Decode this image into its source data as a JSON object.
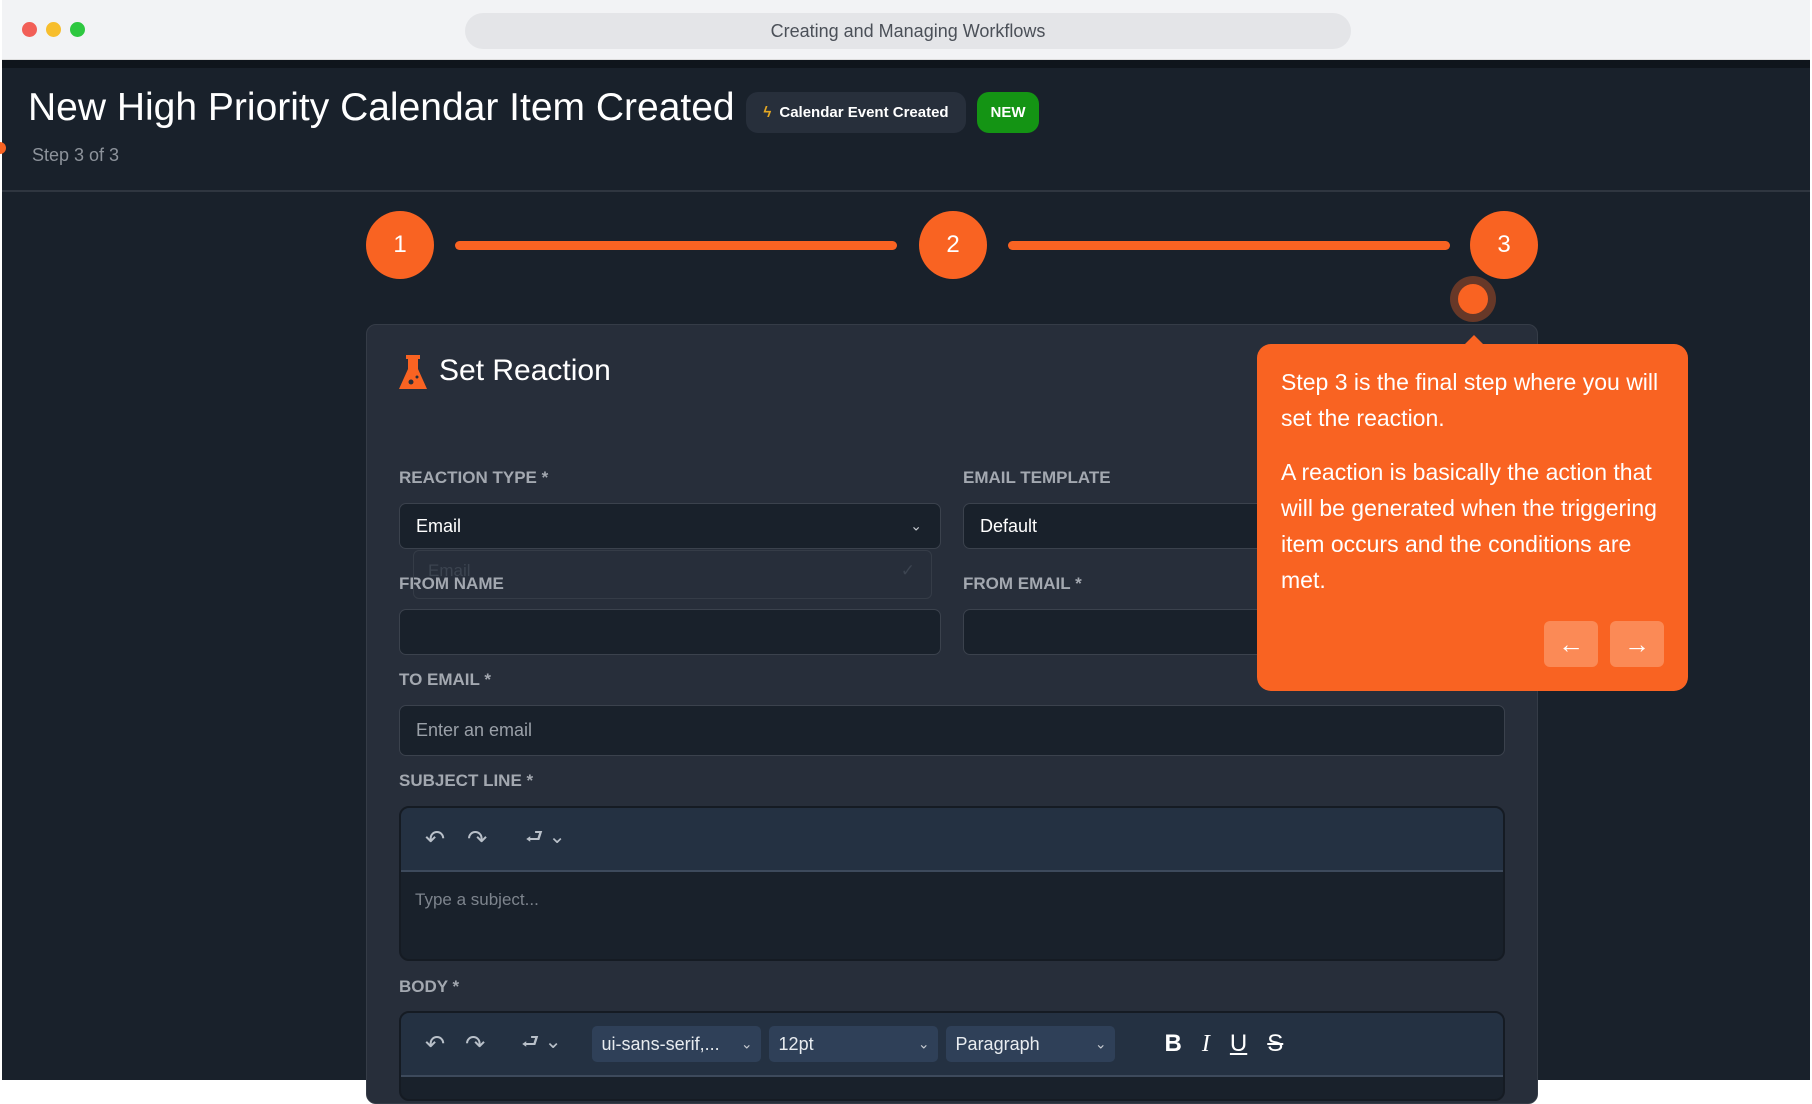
{
  "window": {
    "title": "Creating and Managing Workflows"
  },
  "header": {
    "title": "New High Priority Calendar Item Created",
    "trigger_badge": "Calendar Event Created",
    "new_badge": "NEW",
    "step_text": "Step 3 of 3"
  },
  "stepper": {
    "steps": [
      "1",
      "2",
      "3"
    ],
    "current": 3
  },
  "card": {
    "title": "Set Reaction"
  },
  "form": {
    "reaction_type": {
      "label": "REACTION TYPE *",
      "value": "Email",
      "dropdown_option": "Email"
    },
    "email_template": {
      "label": "EMAIL TEMPLATE",
      "value": "Default"
    },
    "from_name": {
      "label": "FROM NAME",
      "value": ""
    },
    "from_email": {
      "label": "FROM EMAIL *",
      "value": ""
    },
    "to_email": {
      "label": "TO EMAIL *",
      "placeholder": "Enter an email"
    },
    "subject": {
      "label": "SUBJECT LINE *",
      "placeholder": "Type a subject..."
    },
    "body": {
      "label": "BODY *",
      "font": "ui-sans-serif,...",
      "size": "12pt",
      "block": "Paragraph"
    }
  },
  "tooltip": {
    "p1": "Step 3 is the final step where you will set the reaction.",
    "p2": "A reaction is basically the action that will be generated when the triggering item occurs and the conditions are met.",
    "prev": "←",
    "next": "→"
  },
  "colors": {
    "accent": "#f96322",
    "new": "#149414"
  }
}
